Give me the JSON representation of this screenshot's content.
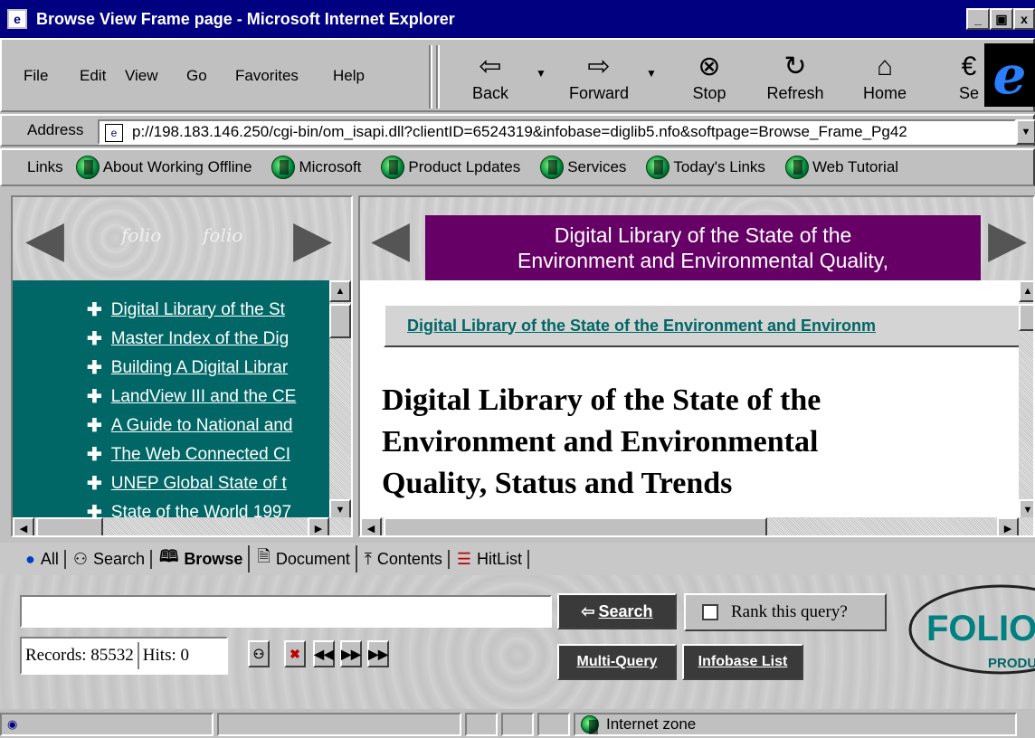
{
  "window": {
    "title": "Browse View Frame page - Microsoft Internet Explorer",
    "controls": [
      "_",
      "&#x25A1;",
      "x"
    ]
  },
  "menu": [
    "File",
    "Edit",
    "View",
    "Go",
    "Favorites",
    "Help"
  ],
  "toolbar": {
    "back": "Back",
    "forward": "Forward",
    "stop": "Stop",
    "refresh": "Refresh",
    "home": "Home",
    "search": "Se"
  },
  "address": {
    "label": "Address",
    "url": "p://198.183.146.250/cgi-bin/om_isapi.dll?clientID=6524319&infobase=diglib5.nfo&softpage=Browse_Frame_Pg42"
  },
  "links": {
    "label": "Links",
    "items": [
      "About Working Offline",
      "Microsoft",
      "Product Lpdates",
      "Services",
      "Today's Links",
      "Web Tutorial"
    ]
  },
  "left_frame": {
    "toc": [
      "Digital Library of the St",
      "Master Index of the Dig",
      "Building A Digital Librar",
      "LandView III and the CE",
      "A Guide to National and",
      "The Web Connected CI",
      "UNEP Global State of t",
      "State of the World 1997"
    ]
  },
  "right_frame": {
    "banner_line1": "Digital Library of the State of the",
    "banner_line2": "Environment and Environmental Quality,",
    "breadcrumb": "Digital Library of the State of the Environment and Environm",
    "title_line1": "Digital Library of the State of the",
    "title_line2": "Environment and Environmental",
    "title_line3": "Quality, Status and Trends"
  },
  "tabs": [
    {
      "label": "All",
      "icon": "globe-icon"
    },
    {
      "label": "Search",
      "icon": "binoculars-icon"
    },
    {
      "label": "Browse",
      "icon": "book-icon",
      "active": true
    },
    {
      "label": "Document",
      "icon": "document-icon"
    },
    {
      "label": "Contents",
      "icon": "contents-icon"
    },
    {
      "label": "HitList",
      "icon": "list-icon"
    }
  ],
  "search": {
    "query": "",
    "search_btn": "Search",
    "rank_label": "Rank this query?",
    "rank_checked": false,
    "records_label": "Records: 85532",
    "hits_label": "Hits: 0",
    "multi_query": "Multi-Query",
    "infobase_list": "Infobase List",
    "logo_text": "FOLIO",
    "logo_sub": "PRODU"
  },
  "status": {
    "zone": "Internet zone"
  },
  "colors": {
    "titlebar": "#000080",
    "toc_bg": "#006666",
    "banner": "#660066",
    "link": "#006666"
  }
}
